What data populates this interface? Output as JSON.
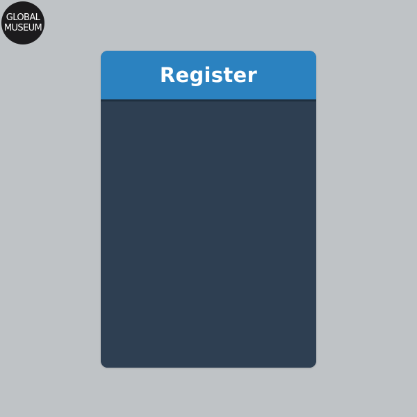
{
  "brand": {
    "logo_line1": "GLOBAL",
    "logo_line2": "MUSEUM"
  },
  "register_panel": {
    "title": "Register"
  },
  "colors": {
    "page_background": "#bfc3c6",
    "header_blue": "#2b82c0",
    "panel_navy": "#2e3f52",
    "logo_black": "#1c1b1d"
  }
}
